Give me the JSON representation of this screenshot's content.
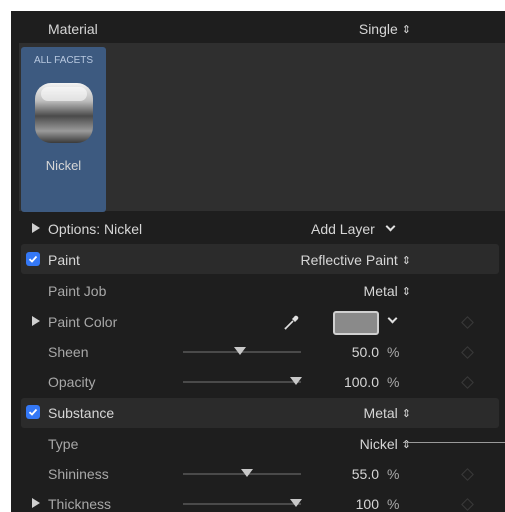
{
  "header": {
    "label": "Material",
    "mode": "Single"
  },
  "facets": {
    "tab_label": "ALL FACETS",
    "material_name": "Nickel"
  },
  "options": {
    "label": "Options: Nickel",
    "add_layer": "Add Layer"
  },
  "paint": {
    "label": "Paint",
    "type_value": "Reflective Paint",
    "paint_job_label": "Paint Job",
    "paint_job_value": "Metal",
    "paint_color_label": "Paint Color",
    "swatch_color": "#8a8a8a",
    "sheen_label": "Sheen",
    "sheen_value": "50.0",
    "sheen_unit": "%",
    "sheen_level": 0.5,
    "opacity_label": "Opacity",
    "opacity_value": "100.0",
    "opacity_unit": "%",
    "opacity_level": 1.0
  },
  "substance": {
    "label": "Substance",
    "type_value_header": "Metal",
    "type_label": "Type",
    "type_value": "Nickel",
    "shininess_label": "Shininess",
    "shininess_value": "55.0",
    "shininess_unit": "%",
    "shininess_level": 0.55,
    "thickness_label": "Thickness",
    "thickness_value": "100",
    "thickness_unit": "%",
    "thickness_level": 1.0
  },
  "colors": {
    "accent": "#3478f6",
    "facet_card": "#3d5a80",
    "panel": "#1e1e1e"
  },
  "icons": {
    "updown": "updown-arrows-icon",
    "eyedropper": "eyedropper-icon",
    "disclosure": "disclosure-triangle-icon"
  }
}
